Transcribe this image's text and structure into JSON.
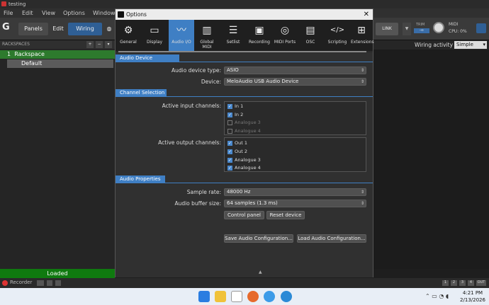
{
  "app": {
    "window_title": "testing",
    "menu": [
      "File",
      "Edit",
      "View",
      "Options",
      "Window"
    ],
    "toolbar": {
      "panels": "Panels",
      "edit": "Edit",
      "wiring": "Wiring",
      "link": "LINK",
      "trim": "TRIM",
      "trim_value": "-∞",
      "midi": "MIDI",
      "cpu": "CPU: 0%"
    },
    "rackspaces_header": "RACKSPACES",
    "rackspace": {
      "number": "1",
      "name": "Rackspace"
    },
    "variation": "Default",
    "wiring_activity": "Wiring activity",
    "wiring_mode": "Simple",
    "status_loaded": "Loaded",
    "recorder": "Recorder",
    "bottom_buttons": [
      "1",
      "2",
      "3",
      "4",
      "OUT"
    ]
  },
  "dialog": {
    "title": "Options",
    "close": "✕",
    "tabs": [
      {
        "label": "General",
        "icon": "toggle-switches-icon",
        "glyph": "⚙"
      },
      {
        "label": "Display",
        "icon": "monitor-icon",
        "glyph": "▭"
      },
      {
        "label": "Audio I/O",
        "icon": "waveform-icon",
        "glyph": "〰"
      },
      {
        "label": "Global MIDI",
        "icon": "piano-keys-icon",
        "glyph": "▥"
      },
      {
        "label": "Setlist",
        "icon": "list-icon",
        "glyph": "☰"
      },
      {
        "label": "Recording",
        "icon": "tape-recorder-icon",
        "glyph": "▣"
      },
      {
        "label": "MIDI Ports",
        "icon": "midi-port-icon",
        "glyph": "◎"
      },
      {
        "label": "OSC",
        "icon": "osc-icon",
        "glyph": "▤"
      },
      {
        "label": "Scripting",
        "icon": "code-icon",
        "glyph": "</>"
      },
      {
        "label": "Extensions",
        "icon": "plus-box-icon",
        "glyph": "⊞"
      }
    ],
    "active_tab": "Audio I/O",
    "audio_device": {
      "section": "Audio Device",
      "type_label": "Audio device type:",
      "type_value": "ASIO",
      "device_label": "Device:",
      "device_value": "MeloAudio USB Audio Device"
    },
    "channels": {
      "section": "Channel Selection",
      "input_label": "Active input channels:",
      "inputs": [
        {
          "name": "In 1",
          "checked": true
        },
        {
          "name": "In 2",
          "checked": true
        },
        {
          "name": "Analogue 3",
          "checked": false
        },
        {
          "name": "Analogue 4",
          "checked": false
        }
      ],
      "output_label": "Active output channels:",
      "outputs": [
        {
          "name": "Out 1",
          "checked": true
        },
        {
          "name": "Out 2",
          "checked": true
        },
        {
          "name": "Analogue 3",
          "checked": true
        },
        {
          "name": "Analogue 4",
          "checked": true
        }
      ]
    },
    "properties": {
      "section": "Audio Properties",
      "sample_rate_label": "Sample rate:",
      "sample_rate_value": "48000 Hz",
      "buffer_label": "Audio buffer size:",
      "buffer_value": "64 samples (1.3 ms)",
      "control_panel": "Control panel",
      "reset_device": "Reset device",
      "save_config": "Save Audio Configuration...",
      "load_config": "Load Audio Configuration..."
    }
  },
  "taskbar": {
    "time": "4:21 PM",
    "date": "2/13/2026"
  }
}
